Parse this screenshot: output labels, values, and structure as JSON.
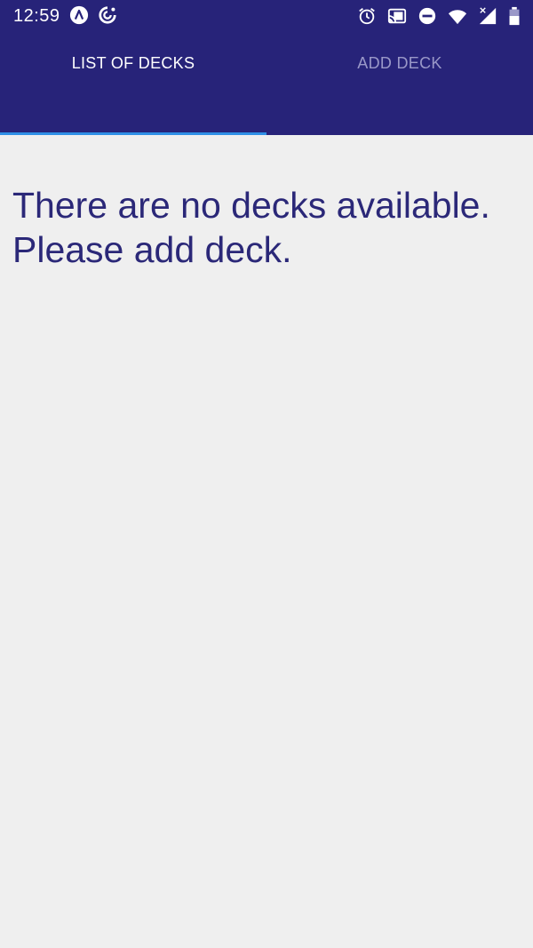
{
  "status_bar": {
    "time": "12:59",
    "left_icons": [
      "app-notification-icon",
      "sync-icon"
    ],
    "right_icons": [
      "alarm-icon",
      "cast-icon",
      "do-not-disturb-icon",
      "wifi-icon",
      "signal-icon",
      "battery-icon"
    ]
  },
  "tabs": [
    {
      "label": "LIST OF DECKS",
      "active": true
    },
    {
      "label": "ADD DECK",
      "active": false
    }
  ],
  "main": {
    "empty_message_line1": "There are no decks available.",
    "empty_message_line2": "Please add deck."
  },
  "colors": {
    "primary": "#272379",
    "indicator": "#2f8fe6",
    "text": "#2b2878",
    "background": "#efefef"
  }
}
